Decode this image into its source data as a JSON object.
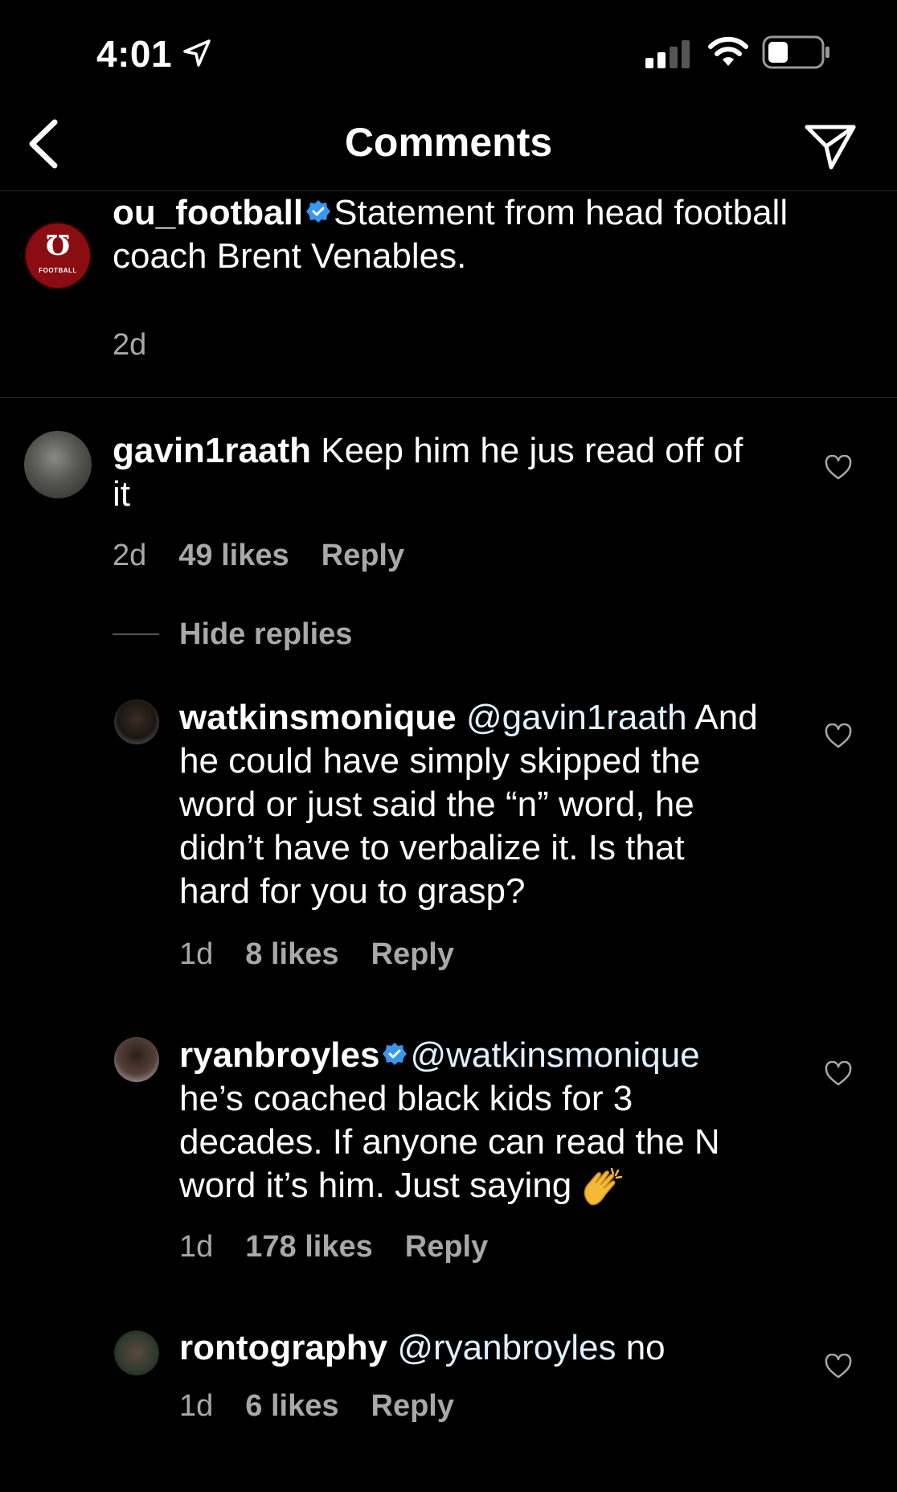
{
  "status_bar": {
    "time": "4:01",
    "icons": [
      "location-arrow-icon",
      "cellular-signal-icon",
      "wifi-icon",
      "battery-icon"
    ]
  },
  "nav": {
    "title": "Comments",
    "back_icon": "chevron-left-icon",
    "share_icon": "send-icon"
  },
  "caption": {
    "username": "ou_football",
    "verified": true,
    "text": "Statement from head football coach Brent Venables.",
    "text_line1": "Statement from head football",
    "text_line2": "coach Brent Venables.",
    "time": "2d",
    "avatar_logo_text": "FOOTBALL"
  },
  "comments": [
    {
      "username": "gavin1raath",
      "text_line1": "Keep him he jus read off of",
      "text_line2": "it",
      "time": "2d",
      "likes": "49 likes",
      "reply_label": "Reply"
    }
  ],
  "hide_replies_label": "Hide replies",
  "replies": [
    {
      "username": "watkinsmonique",
      "mention": "@gavin1raath",
      "line1_rest": "And",
      "line2": "he could have simply skipped the",
      "line3": "word or just said the “n” word, he",
      "line4": "didn’t have to verbalize it. Is that",
      "line5": "hard for you to grasp?",
      "time": "1d",
      "likes": "8 likes",
      "reply_label": "Reply"
    },
    {
      "username": "ryanbroyles",
      "verified": true,
      "mention": "@watkinsmonique",
      "line2": "he’s coached black kids for 3",
      "line3": "decades. If anyone can read the N",
      "line4": "word it’s him. Just saying",
      "emoji": "clapping-hands-emoji",
      "time": "1d",
      "likes": "178 likes",
      "reply_label": "Reply"
    },
    {
      "username": "rontography",
      "mention": "@ryanbroyles",
      "line1_rest": "no",
      "time": "1d",
      "likes": "6 likes",
      "reply_label": "Reply"
    }
  ],
  "colors": {
    "background": "#000000",
    "text": "#ffffff",
    "secondary_text": "#a8a8a8",
    "verified_blue": "#3897f0",
    "ou_crimson": "#8a0d11",
    "divider": "#262626"
  }
}
